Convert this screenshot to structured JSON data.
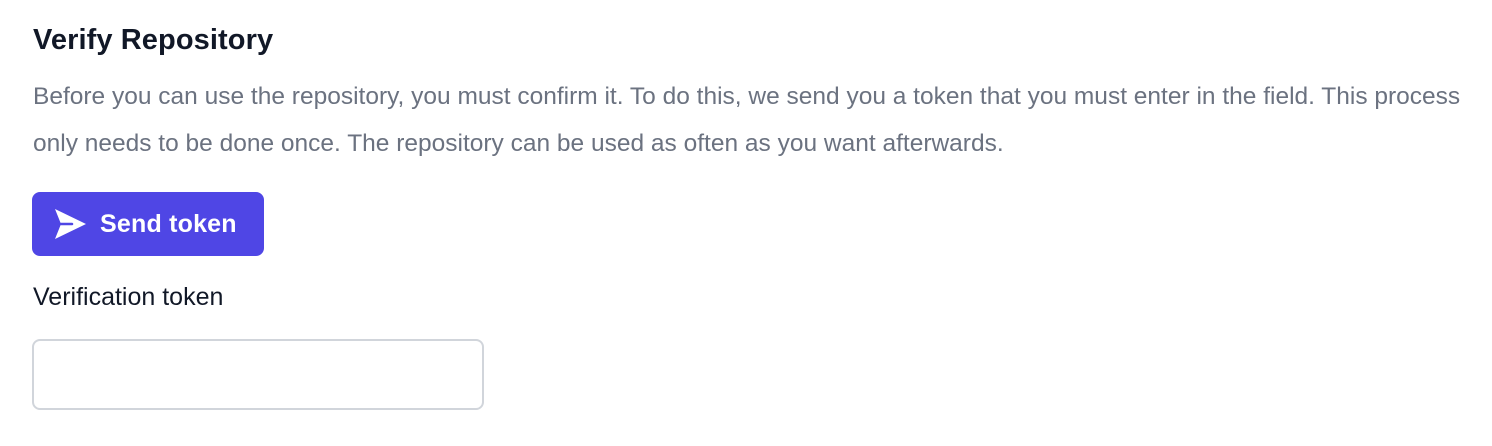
{
  "section": {
    "title": "Verify Repository",
    "description": "Before you can use the repository, you must confirm it. To do this, we send you a token that you must enter in the field. This process only needs to be done once. The repository can be used as often as you want afterwards."
  },
  "send_button": {
    "label": "Send token",
    "icon": "paper-plane-icon",
    "color": "#4f46e5"
  },
  "token_field": {
    "label": "Verification token",
    "value": "",
    "placeholder": ""
  }
}
